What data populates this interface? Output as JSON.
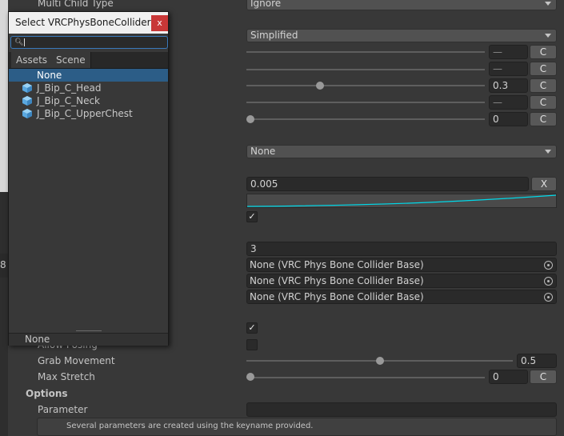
{
  "inspector": {
    "multi_child_label": "Multi Child Type",
    "multi_child_value": "Ignore",
    "dropdown2_value": "Simplified",
    "row_dash": "—",
    "slider_value_3": "0.3",
    "slider_value_5": "0",
    "dropdown3_value": "None",
    "curve_field_value": "0.005",
    "curve_clear_label": "X",
    "int_field_value": "3",
    "colliders": [
      "None (VRC Phys Bone Collider Base)",
      "None (VRC Phys Bone Collider Base)",
      "None (VRC Phys Bone Collider Base)"
    ],
    "left_cut_label": "8",
    "allow_posing_label": "Allow Posing",
    "grab_movement_label": "Grab Movement",
    "grab_movement_value": "0.5",
    "grab_movement_level": 0.5,
    "max_stretch_label": "Max Stretch",
    "max_stretch_value": "0",
    "options_label": "Options",
    "parameter_label": "Parameter",
    "help_text": "Several parameters are created using the keyname provided.",
    "c_label": "C",
    "check_mark": "✓"
  },
  "picker": {
    "title": "Select VRCPhysBoneColliderBase",
    "close_label": "x",
    "search_icon": "🔍",
    "tabs": [
      "Assets",
      "Scene"
    ],
    "items": [
      "None",
      "J_Bip_C_Head",
      "J_Bip_C_Neck",
      "J_Bip_C_UpperChest"
    ],
    "footer": "None"
  },
  "colors": {
    "curve": "#00d8e8",
    "selection": "#2c5d87",
    "close_button": "#c83737"
  }
}
